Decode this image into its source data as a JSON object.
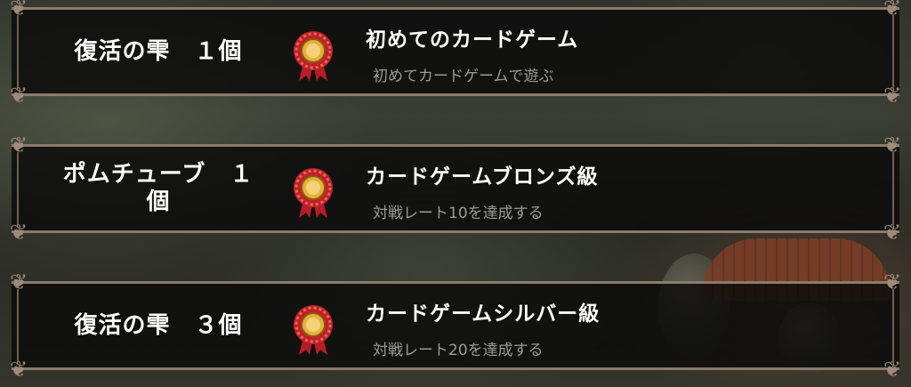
{
  "achievements": [
    {
      "reward": "復活の雫　１個",
      "title": "初めてのカードゲーム",
      "description": "初めてカードゲームで遊ぶ",
      "medal_icon": "medal-rosette-icon"
    },
    {
      "reward": "ポムチューブ　１個",
      "title": "カードゲームブロンズ級",
      "description": "対戦レート10を達成する",
      "medal_icon": "medal-rosette-icon"
    },
    {
      "reward": "復活の雫　３個",
      "title": "カードゲームシルバー級",
      "description": "対戦レート20を達成する",
      "medal_icon": "medal-rosette-icon"
    }
  ],
  "colors": {
    "panel_border": "#8c7a6b",
    "title_text": "#ffffff",
    "description_text": "#9a9a9a",
    "medal_red": "#c0202a",
    "medal_gold": "#e3b33a"
  }
}
